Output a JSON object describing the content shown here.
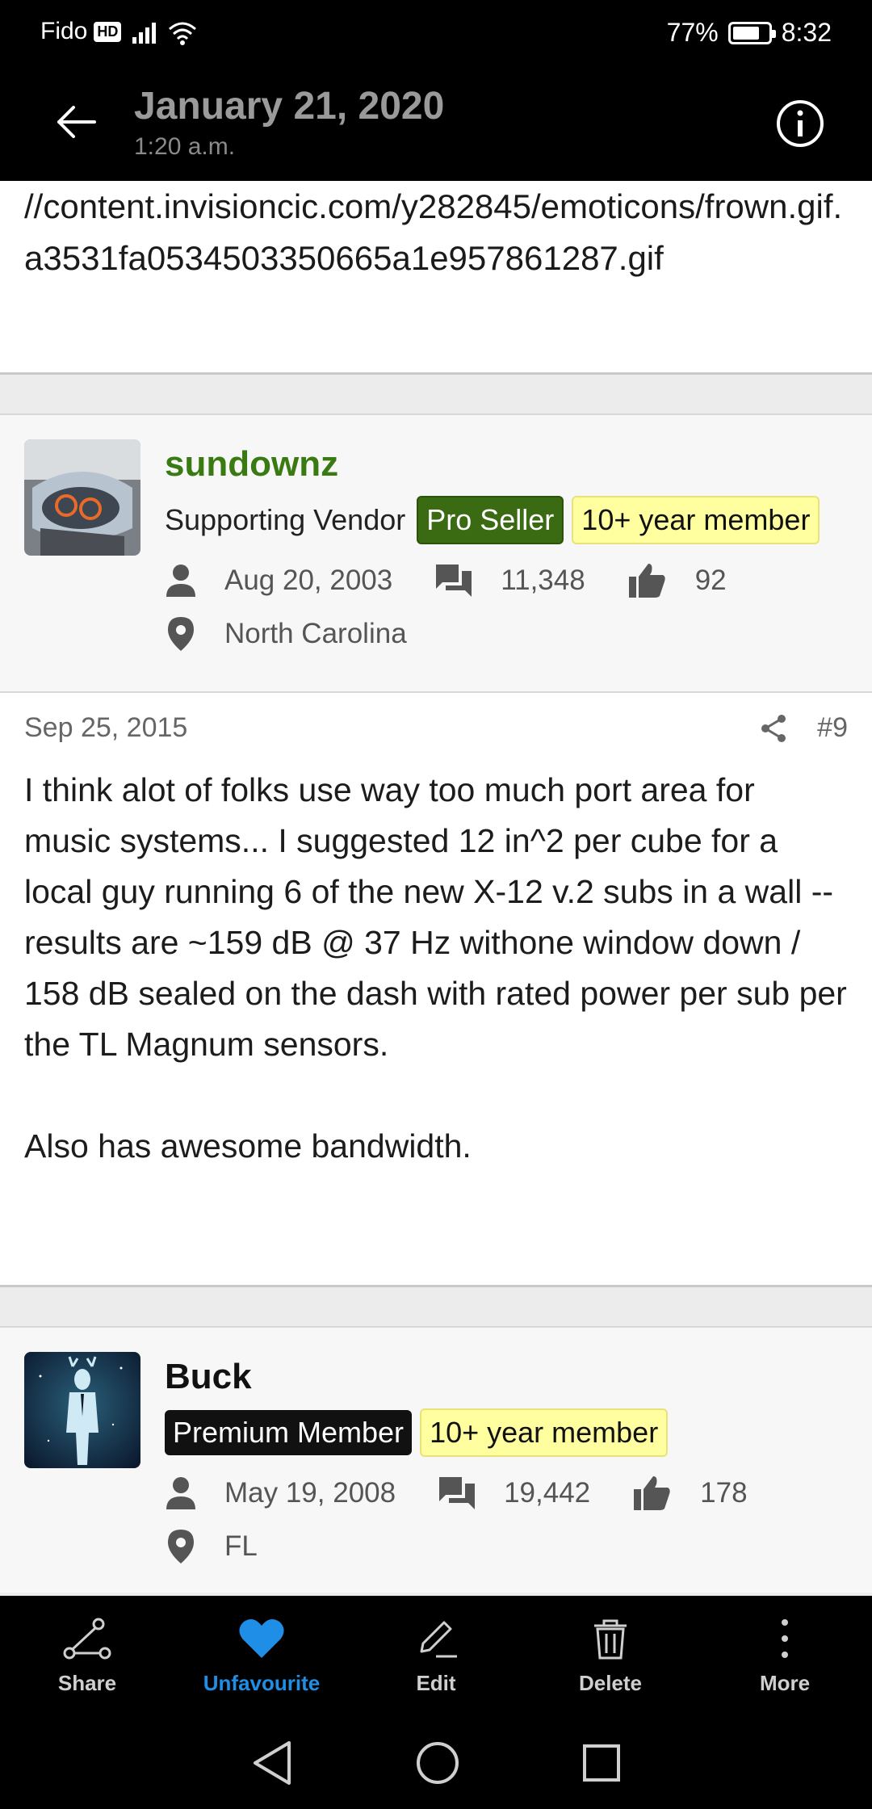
{
  "status_bar": {
    "carrier": "Fido",
    "hd_badge": "HD",
    "battery_percent_label": "77%",
    "battery_level": 0.77,
    "time": "8:32"
  },
  "header": {
    "title": "January 21, 2020",
    "subtitle": "1:20 a.m.",
    "back_icon": "arrow-left-icon",
    "info_icon": "info-icon"
  },
  "previous_post": {
    "text": "//content.invisioncic.com/y282845/emoticons/frown.gif.a3531fa0534503350665a1e957861287.gif"
  },
  "authors": [
    {
      "name": "sundownz",
      "role": "Supporting Vendor",
      "badges": [
        "Pro Seller",
        "10+ year member"
      ],
      "joined": "Aug 20, 2003",
      "posts": "11,348",
      "likes": "92",
      "location": "North Carolina",
      "name_color": "#3a7a12"
    },
    {
      "name": "Buck",
      "role": "",
      "badges": [
        "Premium Member",
        "10+ year member"
      ],
      "joined": "May 19, 2008",
      "posts": "19,442",
      "likes": "178",
      "location": "FL",
      "name_color": "#111111"
    }
  ],
  "post": {
    "date": "Sep 25, 2015",
    "number": "#9",
    "paragraph_1": "I think alot of folks use way too much port area for music systems... I suggested 12 in^2 per cube for a local guy running 6 of the new X-12 v.2 subs in a wall -- results are ~159 dB @ 37 Hz withone window down / 158 dB sealed on the dash with rated power per sub per the TL Magnum sensors.",
    "paragraph_2": "Also has awesome bandwidth."
  },
  "actions": {
    "share": "Share",
    "unfavourite": "Unfavourite",
    "edit": "Edit",
    "delete": "Delete",
    "more": "More",
    "active_color": "#1e8ee6"
  }
}
